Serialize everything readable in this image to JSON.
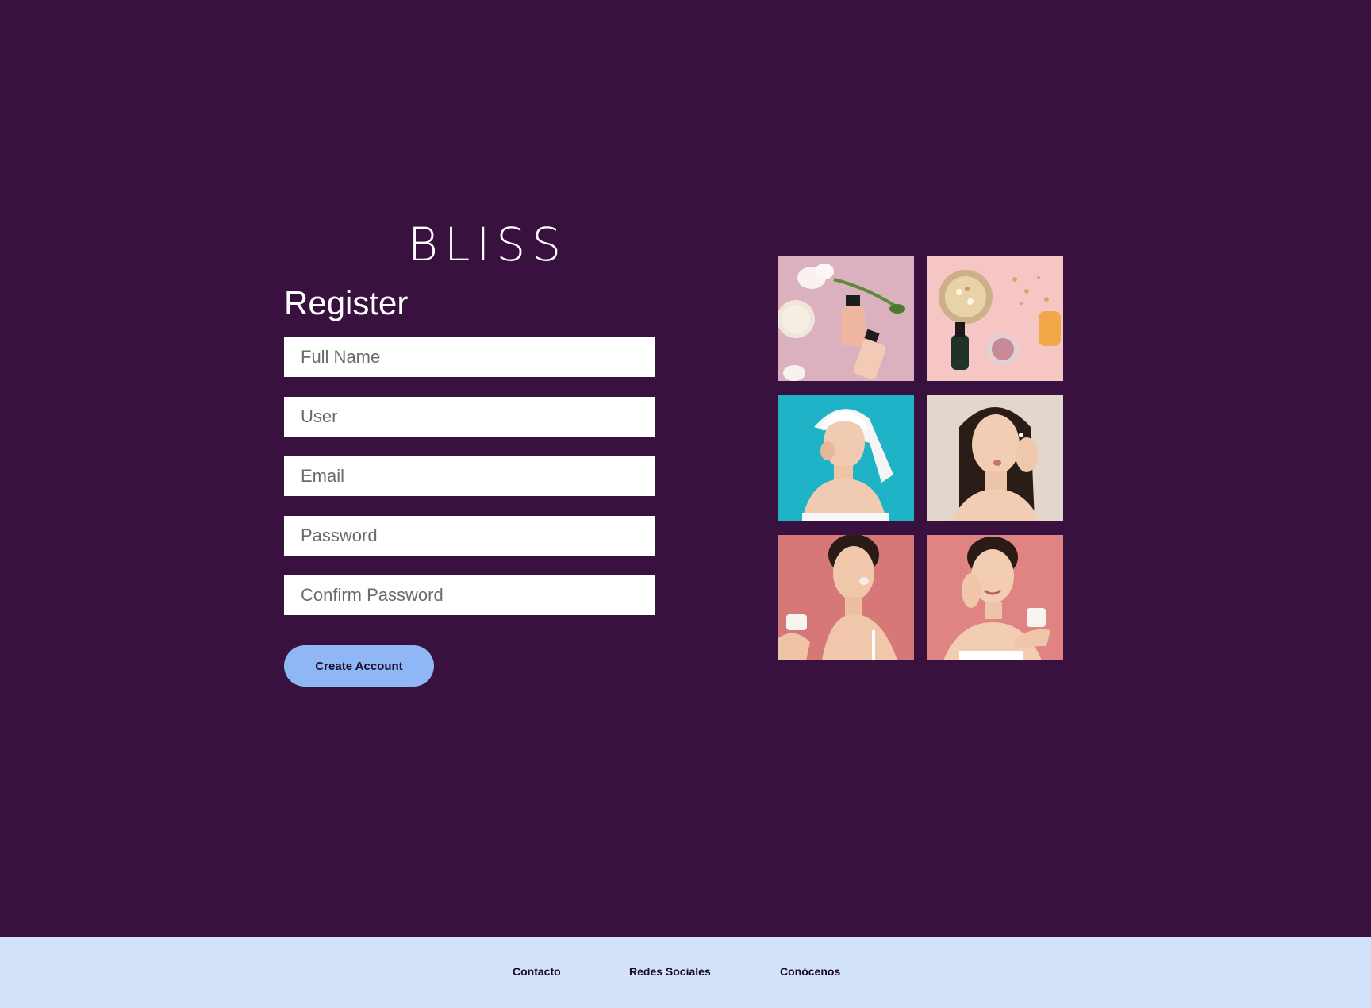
{
  "brand": {
    "name": "BLISS"
  },
  "register": {
    "title": "Register",
    "fields": {
      "full_name_placeholder": "Full Name",
      "user_placeholder": "User",
      "email_placeholder": "Email",
      "password_placeholder": "Password",
      "confirm_password_placeholder": "Confirm Password"
    },
    "submit_label": "Create Account"
  },
  "gallery": {
    "images": [
      "skincare-bottles-flowers-image",
      "skincare-oil-granules-image",
      "woman-towel-cotton-pad-image",
      "woman-applying-cream-image",
      "woman-holding-cream-jar-image",
      "woman-smiling-cream-jar-image"
    ]
  },
  "footer": {
    "links": [
      "Contacto",
      "Redes Sociales",
      "Conócenos"
    ]
  },
  "colors": {
    "background": "#38113e",
    "button": "#8fb7f5",
    "footer": "#d1e2f9"
  }
}
